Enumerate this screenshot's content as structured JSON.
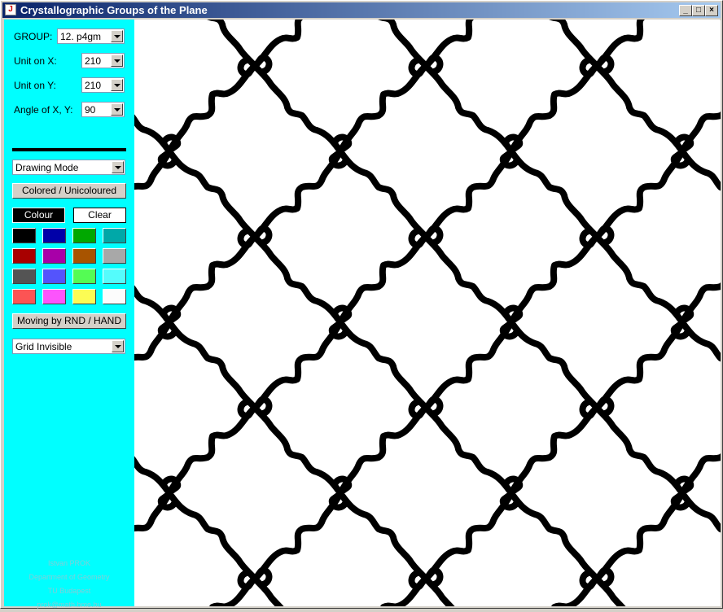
{
  "window": {
    "title": "Crystallographic Groups of the Plane",
    "buttons": [
      "_",
      "□",
      "×"
    ]
  },
  "controls": {
    "group_label": "GROUP:",
    "group_value": "12. p4gm",
    "unit_x_label": "Unit on X:",
    "unit_x_value": "210",
    "unit_y_label": "Unit on Y:",
    "unit_y_value": "210",
    "angle_label": "Angle of X, Y:",
    "angle_value": "90",
    "mode_value": "Drawing Mode",
    "colored_button": "Colored / Unicoloured",
    "colour_button": "Colour",
    "clear_button": "Clear",
    "moving_button": "Moving by RND / HAND",
    "grid_value": "Grid Invisible"
  },
  "palette": [
    "#000000",
    "#0000a8",
    "#00a800",
    "#00a8a8",
    "#a80000",
    "#a800a8",
    "#a85400",
    "#a8a8a8",
    "#545454",
    "#5454fc",
    "#54fc54",
    "#54fcfc",
    "#fc5454",
    "#fc54fc",
    "#fcfc54",
    "#fcfcfc"
  ],
  "credits": [
    "Istvan PROK",
    "Department of Geometry",
    "TU Budapest",
    "prok@math.bme.hu"
  ]
}
